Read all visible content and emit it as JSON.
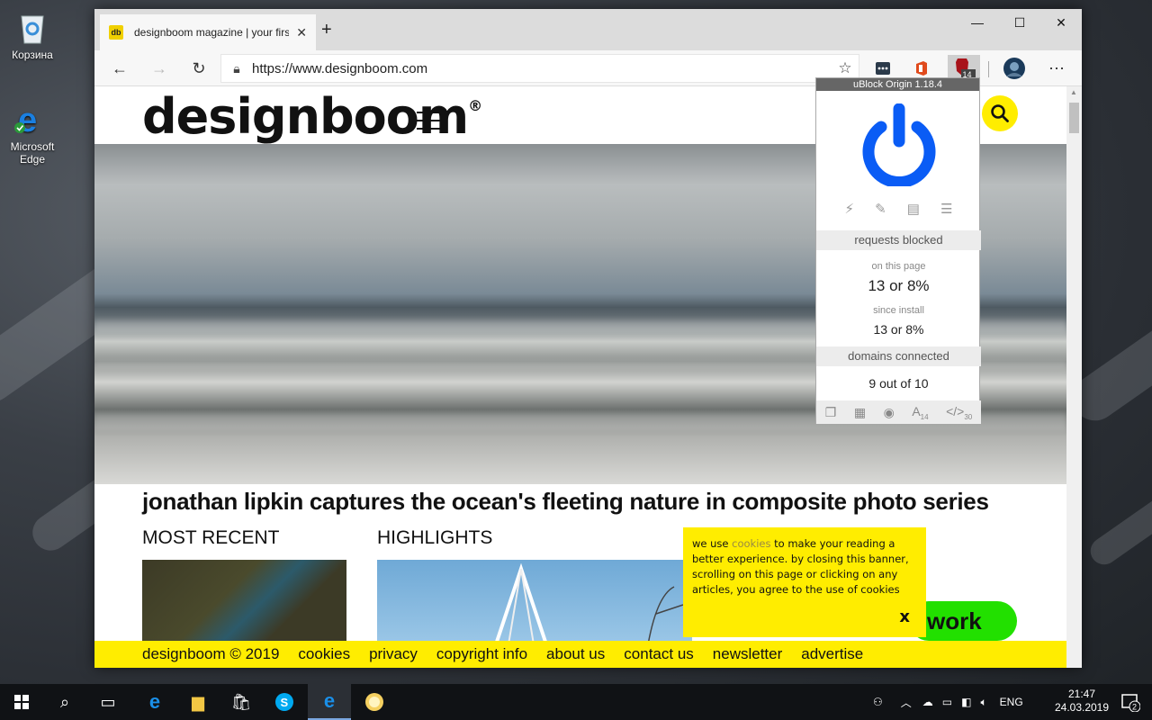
{
  "desktop": {
    "icons": [
      {
        "label": "Корзина"
      },
      {
        "label": "Microsoft Edge"
      }
    ]
  },
  "browser": {
    "tab": {
      "title": "designboom magazine | your firs",
      "favicon_text": "db"
    },
    "url": "https://www.designboom.com",
    "ublock_badge": "13"
  },
  "page": {
    "logo": "designboom",
    "logo_mark": "®",
    "headline": "jonathan lipkin captures the ocean's fleeting nature in composite photo series",
    "sections": [
      "MOST RECENT",
      "HIGHLIGHTS"
    ],
    "green_button": "work",
    "footer": [
      "designboom © 2019",
      "cookies",
      "privacy",
      "copyright info",
      "about us",
      "contact us",
      "newsletter",
      "advertise"
    ],
    "cookie_banner": {
      "text_before": "we use ",
      "link": "cookies",
      "text_after": " to make your reading a better experience. by closing this banner, scrolling on this page or clicking on any articles, you agree to the use of cookies",
      "close": "x"
    }
  },
  "ublock": {
    "title": "uBlock Origin 1.18.4",
    "requests_blocked": "requests blocked",
    "on_this_page_label": "on this page",
    "on_this_page_value": "13 or 8%",
    "since_install_label": "since install",
    "since_install_value": "13 or 8%",
    "domains_connected": "domains connected",
    "domains_value": "9 out of 10",
    "font_count": "14",
    "script_count": "30"
  },
  "taskbar": {
    "lang": "ENG",
    "time": "21:47",
    "date": "24.03.2019",
    "notifications": "2"
  },
  "colors": {
    "accent_yellow": "#ffed00",
    "power_blue": "#0a5cf5",
    "green": "#22e000"
  }
}
